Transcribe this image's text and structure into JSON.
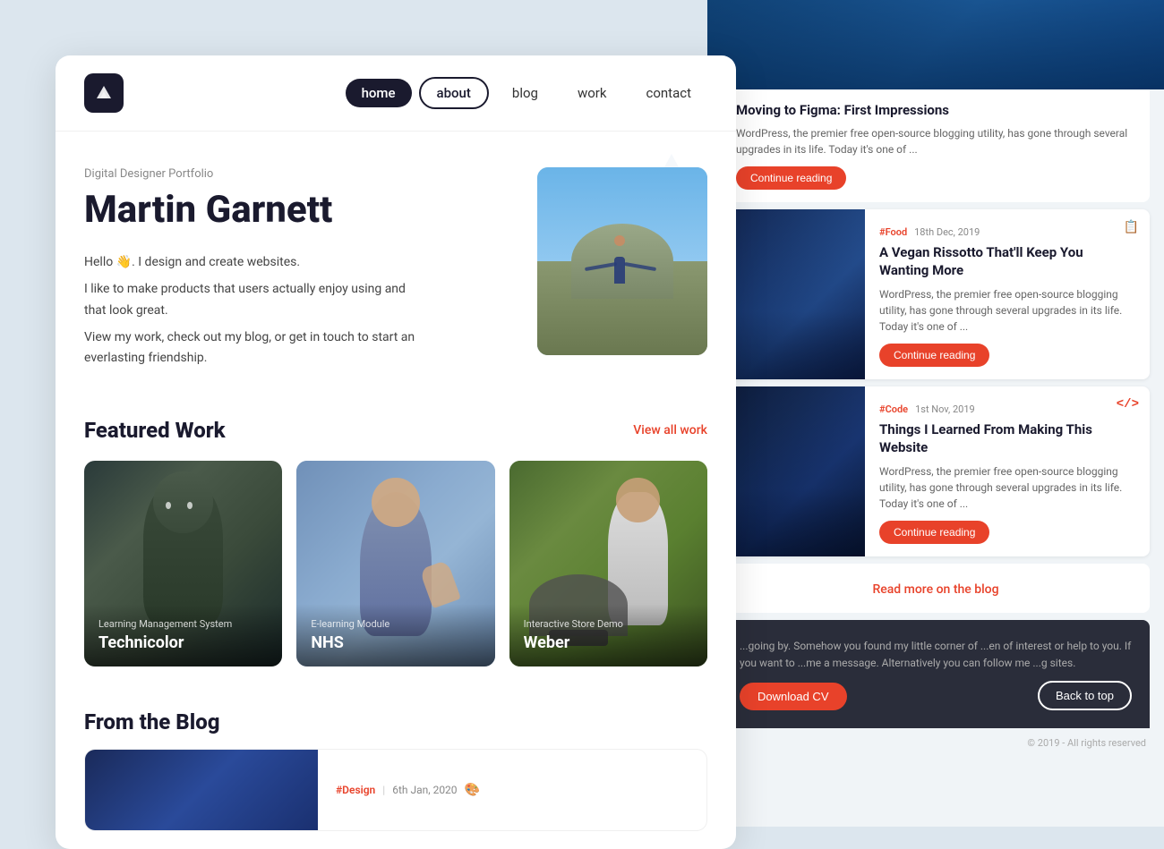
{
  "brand": {
    "logo_text": "▲▲",
    "logo_label": "Martin Garnett Logo"
  },
  "nav": {
    "links": [
      {
        "id": "home",
        "label": "home",
        "state": "active-home"
      },
      {
        "id": "about",
        "label": "about",
        "state": "active-about"
      },
      {
        "id": "blog",
        "label": "blog",
        "state": ""
      },
      {
        "id": "work",
        "label": "work",
        "state": ""
      },
      {
        "id": "contact",
        "label": "contact",
        "state": ""
      }
    ]
  },
  "hero": {
    "subtitle": "Digital Designer Portfolio",
    "name": "Martin Garnett",
    "desc_line1": "Hello 👋. I design and create websites.",
    "desc_line2": "I like to make products that users actually enjoy using and that look great.",
    "desc_line3": "View my work, check out my blog, or get in touch to start an everlasting friendship."
  },
  "featured_work": {
    "title": "Featured Work",
    "view_all": "View all work",
    "items": [
      {
        "id": "technicolor",
        "category": "Learning Management System",
        "title": "Technicolor",
        "theme": "groot"
      },
      {
        "id": "nhs",
        "category": "E-learning Module",
        "title": "NHS",
        "theme": "nhs"
      },
      {
        "id": "weber",
        "category": "Interactive Store Demo",
        "title": "Weber",
        "theme": "weber"
      }
    ]
  },
  "from_blog": {
    "title": "From the Blog",
    "preview": {
      "tag": "#Design",
      "date": "6th Jan, 2020",
      "icon": "🎨"
    }
  },
  "right_panel": {
    "top_article": {
      "title": "Moving to Figma: First Impressions",
      "excerpt": "WordPress, the premier free open-source blogging utility, has gone through several upgrades in its life. Today it's one of ...",
      "button": "Continue reading"
    },
    "articles": [
      {
        "tag": "#Food",
        "date": "18th Dec, 2019",
        "title": "A Vegan Rissotto That'll Keep You Wanting More",
        "excerpt": "WordPress, the premier free open-source blogging utility, has gone through several upgrades in its life. Today it's one of ...",
        "button": "Continue reading",
        "icon": "📋",
        "theme": "city1"
      },
      {
        "tag": "#Code",
        "date": "1st Nov, 2019",
        "title": "Things I Learned From Making This Website",
        "excerpt": "WordPress, the premier free open-source blogging utility, has gone through several upgrades in its life. Today it's one of ...",
        "button": "Continue reading",
        "icon": "<>",
        "theme": "city2"
      }
    ],
    "read_more": "Read more on the blog",
    "footer": {
      "text": "...going by. Somehow you found my little corner of ...en of interest or help to you. If you want to ...me a message. Alternatively you can follow me ...g sites.",
      "download_cv": "Download CV",
      "back_to_top": "Back to top",
      "copyright": "© 2019 - All rights reserved"
    }
  }
}
